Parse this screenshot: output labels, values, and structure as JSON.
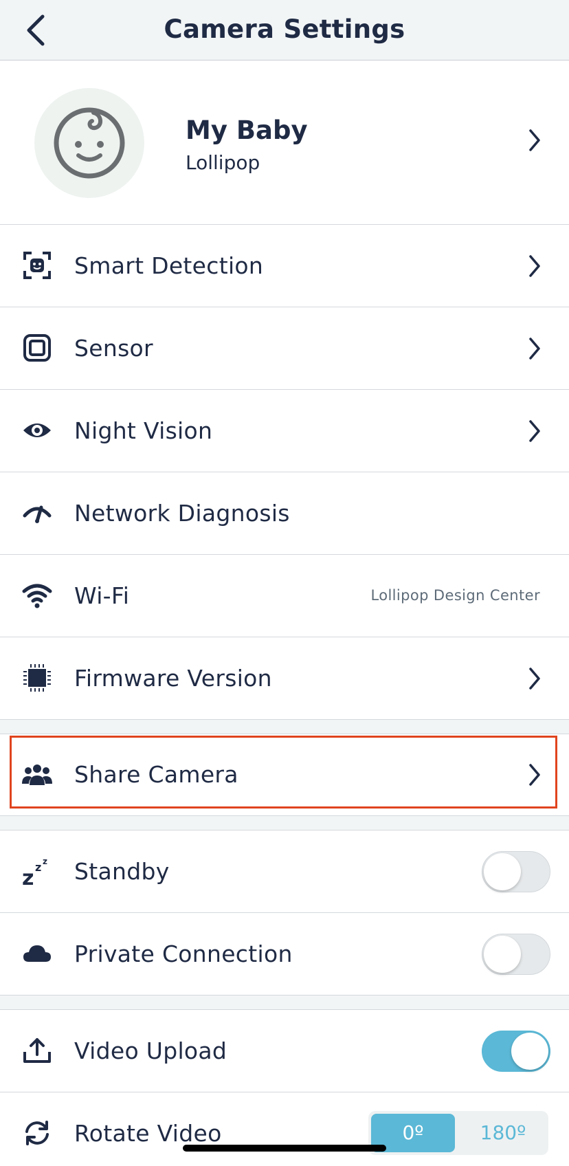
{
  "header": {
    "title": "Camera Settings"
  },
  "profile": {
    "name": "My Baby",
    "subtitle": "Lollipop"
  },
  "rows": {
    "smart_detection": {
      "label": "Smart Detection"
    },
    "sensor": {
      "label": "Sensor"
    },
    "night_vision": {
      "label": "Night Vision"
    },
    "network_diagnosis": {
      "label": "Network Diagnosis"
    },
    "wifi": {
      "label": "Wi-Fi",
      "value": "Lollipop Design Center"
    },
    "firmware": {
      "label": "Firmware Version"
    },
    "share_camera": {
      "label": "Share Camera"
    },
    "standby": {
      "label": "Standby",
      "enabled": false
    },
    "private_connection": {
      "label": "Private Connection",
      "enabled": false
    },
    "video_upload": {
      "label": "Video Upload",
      "enabled": true
    },
    "rotate_video": {
      "label": "Rotate Video",
      "options": [
        "0º",
        "180º"
      ],
      "selected": "0º"
    }
  },
  "colors": {
    "text": "#1f2a44",
    "accent": "#5bb8d6",
    "highlight": "#e0441f",
    "header_bg": "#f2f5f6"
  },
  "icons": {
    "back": "chevron-left-icon",
    "avatar": "baby-face-icon",
    "smart_detection": "face-scan-icon",
    "sensor": "sensor-square-icon",
    "night_vision": "eye-icon",
    "network_diagnosis": "speed-gauge-icon",
    "wifi": "wifi-icon",
    "firmware": "chip-icon",
    "share_camera": "people-icon",
    "standby": "zzz-icon",
    "private_connection": "cloud-icon",
    "video_upload": "upload-icon",
    "rotate_video": "rotate-icon"
  }
}
